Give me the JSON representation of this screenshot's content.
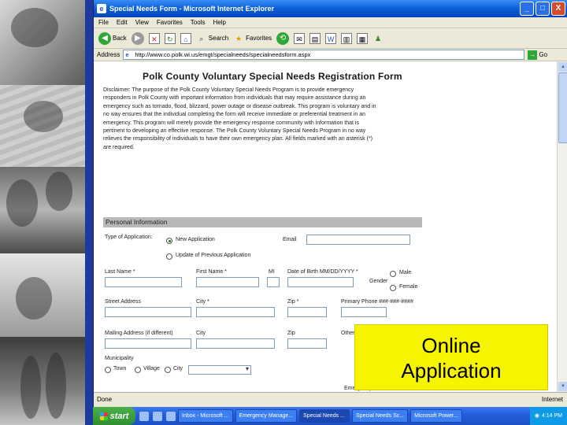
{
  "window": {
    "title": "Special Needs Form - Microsoft Internet Explorer",
    "buttons": {
      "minimize": "_",
      "maximize": "□",
      "close": "X"
    }
  },
  "menu": {
    "items": [
      "File",
      "Edit",
      "View",
      "Favorites",
      "Tools",
      "Help"
    ]
  },
  "toolbar": {
    "back_label": "Back",
    "search_label": "Search",
    "favorites_label": "Favorites"
  },
  "address": {
    "label": "Address",
    "url": "http://www.co.polk.wi.us/emgt/specialneeds/specialneedsform.aspx",
    "go_label": "Go"
  },
  "form": {
    "title": "Polk County Voluntary Special Needs Registration Form",
    "disclaimer": "Disclaimer: The purpose of the Polk County Voluntary Special Needs Program is to provide emergency responders in Polk County with important information from individuals that may require assistance during an emergency such as tornado, flood, blizzard, power outage or disease outbreak. This program is voluntary and in no way ensures that the individual completing the form will receive immediate or preferential treatment in an emergency. This program will merely provide the emergency response community with information that is pertinent to developing an effective response. The Polk County Voluntary Special Needs Program in no way relieves the responsibility of individuals to have their own emergency plan. All fields marked with an asterisk (*) are required.",
    "section": "Personal Information",
    "type_label": "Type of Application:",
    "type_options": [
      "New Application",
      "Update of Previous Application"
    ],
    "email_label": "Email",
    "last_name_label": "Last Name *",
    "first_name_label": "First Name *",
    "mi_label": "MI",
    "dob_label": "Date of Birth MM/DD/YYYY *",
    "gender_label": "Gender",
    "gender_options": [
      "Male",
      "Female"
    ],
    "street_label": "Street Address",
    "city_label": "City *",
    "zip_label": "Zip *",
    "phone_label": "Primary Phone ###-###-####",
    "mailing_label": "Mailing Address (if different)",
    "mailing_city_label": "City",
    "mailing_zip_label": "Zip",
    "other_label": "Other",
    "municipality_label": "Municipality",
    "municipality_options": [
      "Town",
      "Village",
      "City"
    ],
    "bottom_label": "Emergency"
  },
  "status": {
    "text": "Done",
    "zone": "Internet"
  },
  "taskbar": {
    "start_label": "start",
    "tasks": [
      "Inbox - Microsoft ...",
      "Emergency Manage...",
      "Special Needs ...",
      "Special Needs Sc...",
      "Microsoft Power..."
    ],
    "clock": "4:14 PM"
  },
  "callout": {
    "line1": "Online",
    "line2": "Application"
  }
}
